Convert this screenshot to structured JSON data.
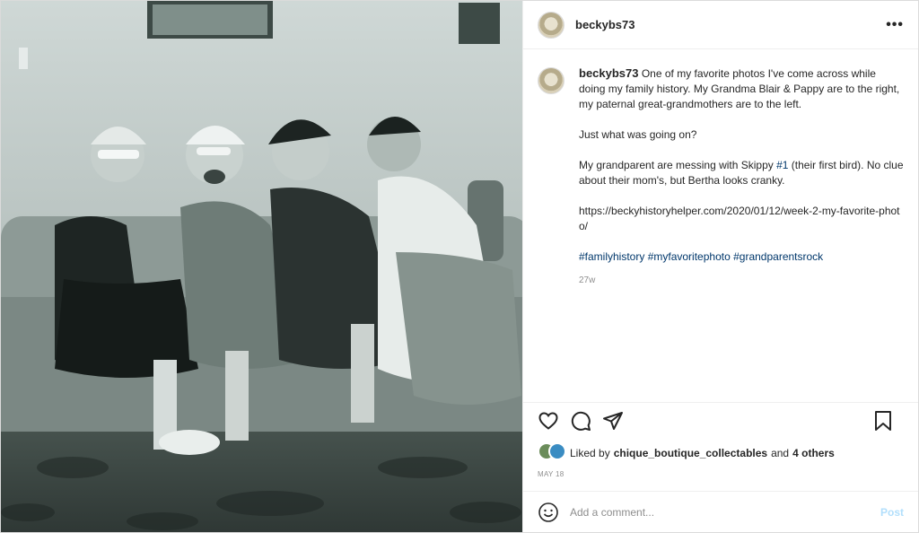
{
  "post": {
    "username": "beckybs73",
    "more_label": "•••",
    "caption": {
      "username": "beckybs73",
      "text1": "One of my favorite photos I've come across while doing my family history. My Grandma Blair & Pappy are to the right, my paternal great-grandmothers are to the left.",
      "text2": "Just what was going on?",
      "text3_a": "My grandparent are messing with Skippy ",
      "text3_tag": "#1",
      "text3_b": " (their first bird). No clue about their mom's, but Bertha looks cranky.",
      "link": "https://beckyhistoryhelper.com/2020/01/12/week-2-my-favorite-photo/",
      "hashtags": [
        "#familyhistory",
        "#myfavoritephoto",
        "#grandparentsrock"
      ],
      "age": "27w"
    },
    "likes": {
      "prefix": "Liked by",
      "user": "chique_boutique_collectables",
      "and": "and",
      "others": "4 others"
    },
    "date": "MAY 18",
    "comment_placeholder": "Add a comment...",
    "post_button": "Post",
    "icons": [
      "heart-icon",
      "comment-icon",
      "share-icon",
      "bookmark-icon",
      "emoji-icon"
    ]
  }
}
